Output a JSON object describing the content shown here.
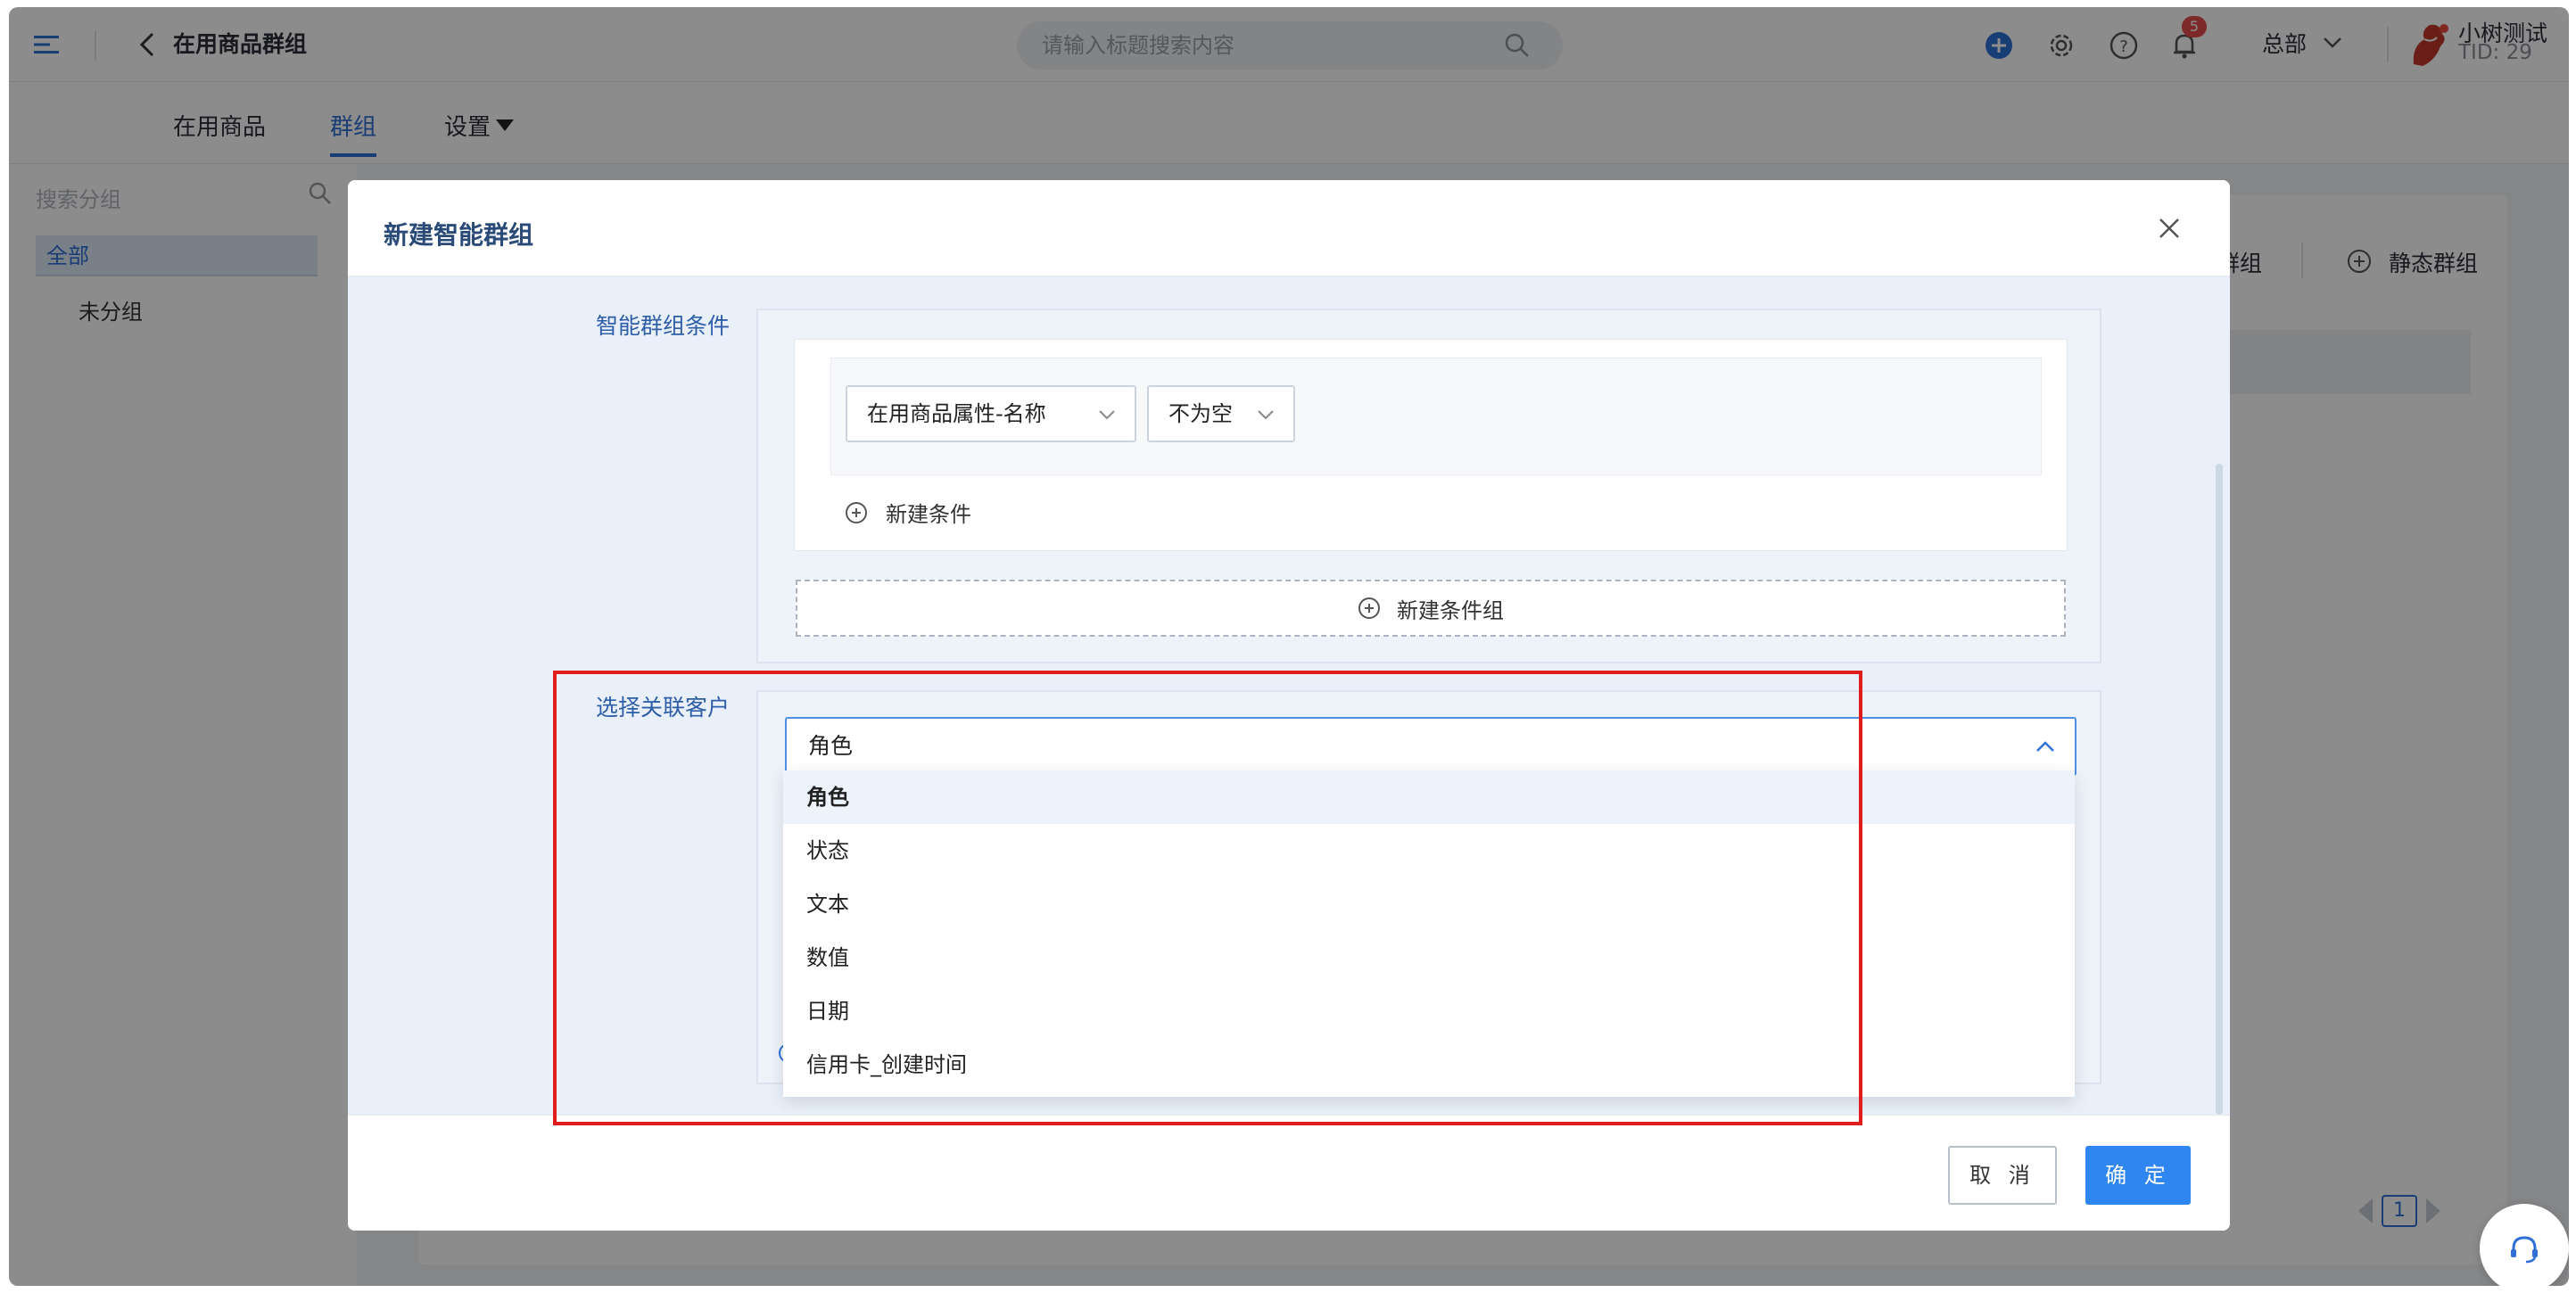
{
  "header": {
    "page_title": "在用商品群组",
    "search_placeholder": "请输入标题搜索内容",
    "notification_count": "5",
    "org": "总部",
    "user_name": "小树测试",
    "user_tid": "TID: 29"
  },
  "subnav": {
    "tabs": [
      {
        "label": "在用商品"
      },
      {
        "label": "群组"
      },
      {
        "label": "设置"
      }
    ],
    "active_tab": "群组"
  },
  "left": {
    "search_placeholder": "搜索分组",
    "groups": [
      "全部",
      "未分组"
    ]
  },
  "right": {
    "smart_group_btn": "群组",
    "static_group_btn": "静态群组",
    "page": "1"
  },
  "modal": {
    "title": "新建智能群组",
    "condition_label": "智能群组条件",
    "condition": {
      "field": "在用商品属性-名称",
      "operator": "不为空"
    },
    "add_condition": "新建条件",
    "add_condition_group": "新建条件组",
    "customer_label": "选择关联客户",
    "customer_selected": "角色",
    "dropdown_options": [
      "角色",
      "状态",
      "文本",
      "数值",
      "日期",
      "信用卡_创建时间"
    ],
    "cancel": "取 消",
    "confirm": "确 定"
  },
  "colors": {
    "accent": "#2f6fd6",
    "primary_button": "#2f86f0",
    "highlight_box": "#e01c1c",
    "badge": "#e34b4b"
  }
}
